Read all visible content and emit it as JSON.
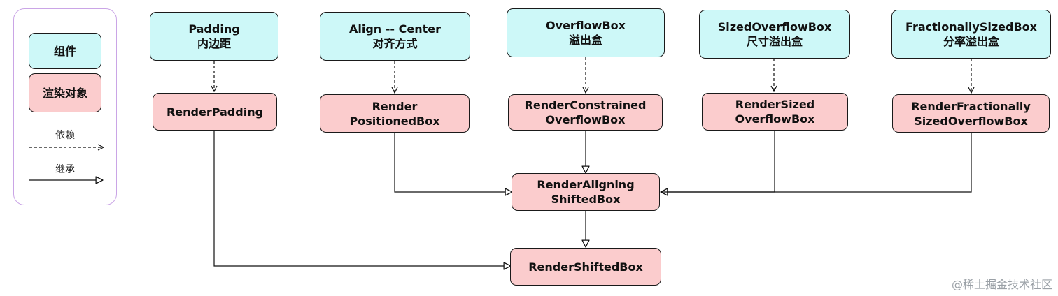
{
  "legend": {
    "widget": "组件",
    "render_object": "渲染对象",
    "dependency": "依赖",
    "inheritance": "继承"
  },
  "widgets": {
    "padding": [
      "Padding",
      "内边距"
    ],
    "align": [
      "Align -- Center",
      "对齐方式"
    ],
    "overflow": [
      "OverflowBox",
      "溢出盒"
    ],
    "sized_overflow": [
      "SizedOverflowBox",
      "尺寸溢出盒"
    ],
    "fractionally_sized": [
      "FractionallySizedBox",
      "分率溢出盒"
    ]
  },
  "render_objects": {
    "padding": [
      "RenderPadding"
    ],
    "positioned": [
      "Render",
      "PositionedBox"
    ],
    "constrained_overflow": [
      "RenderConstrained",
      "OverflowBox"
    ],
    "sized_overflow": [
      "RenderSized",
      "OverflowBox"
    ],
    "fractionally_sized": [
      "RenderFractionally",
      "SizedOverflowBox"
    ],
    "aligning_shifted": [
      "RenderAligning",
      "ShiftedBox"
    ],
    "shifted": [
      "RenderShiftedBox"
    ]
  },
  "watermark": "@稀土掘金技术社区",
  "colors": {
    "widget_fill": "#cdf8f8",
    "render_fill": "#fbcccd",
    "legend_border": "#caa5e6"
  }
}
